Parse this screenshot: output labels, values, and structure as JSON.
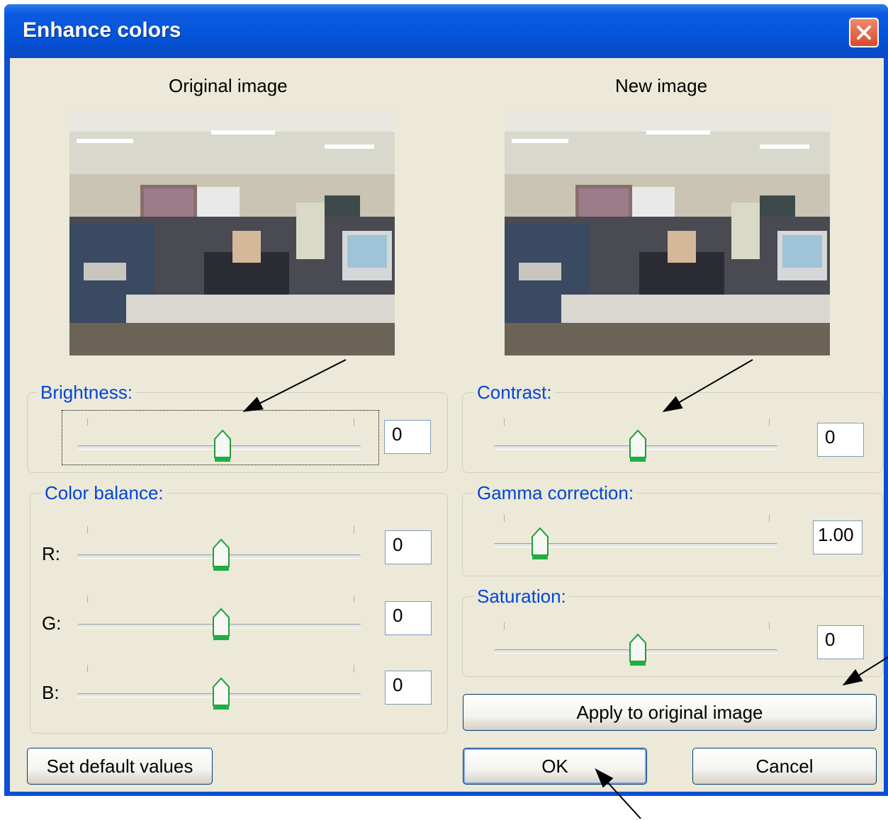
{
  "window": {
    "title": "Enhance colors"
  },
  "images": {
    "original_label": "Original image",
    "new_label": "New image"
  },
  "brightness": {
    "title": "Brightness:",
    "value": "0"
  },
  "color_balance": {
    "title": "Color balance:",
    "r": {
      "label": "R:",
      "value": "0"
    },
    "g": {
      "label": "G:",
      "value": "0"
    },
    "b": {
      "label": "B:",
      "value": "0"
    }
  },
  "contrast": {
    "title": "Contrast:",
    "value": "0"
  },
  "gamma": {
    "title": "Gamma correction:",
    "value": "1.00"
  },
  "saturation": {
    "title": "Saturation:",
    "value": "0"
  },
  "buttons": {
    "apply": "Apply to original image",
    "set_default": "Set default values",
    "ok": "OK",
    "cancel": "Cancel"
  },
  "colors": {
    "titlebar": "#0553d8",
    "dialog_bg": "#ece9d8",
    "group_title": "#0046d5",
    "close": "#d9492a"
  }
}
